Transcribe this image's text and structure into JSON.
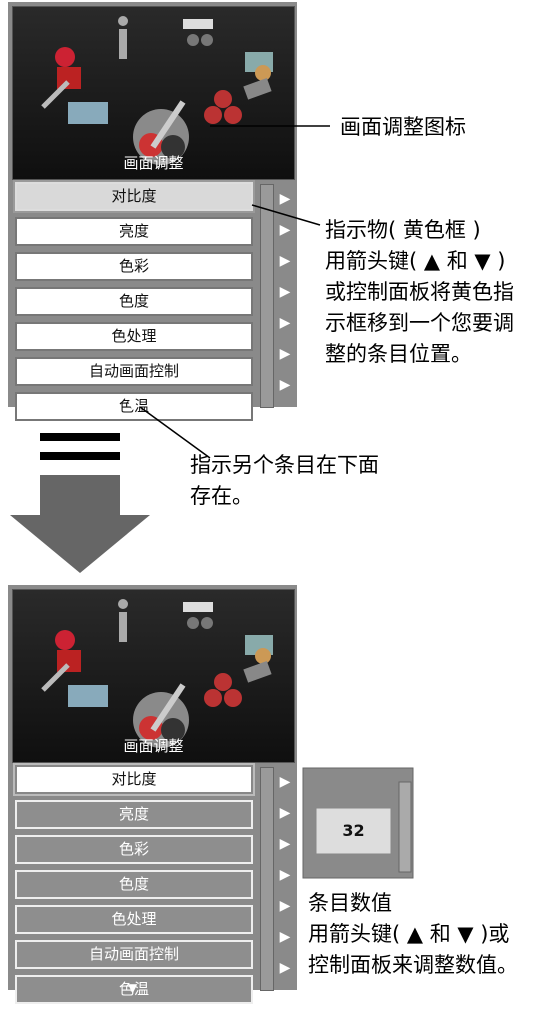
{
  "panel_top": {
    "icon_label": "画面调整",
    "items": [
      "对比度",
      "亮度",
      "色彩",
      "色度",
      "色处理",
      "自动画面控制",
      "色温"
    ]
  },
  "panel_bottom": {
    "icon_label": "画面调整",
    "items": [
      "对比度",
      "亮度",
      "色彩",
      "色度",
      "色处理",
      "自动画面控制",
      "色温"
    ],
    "value": "32"
  },
  "callouts": {
    "icon": "画面调整图标",
    "indicator_1": "指示物( 黄色框 )",
    "indicator_2": "用箭头键( ▲ 和 ▼ )",
    "indicator_3": "或控制面板将黄色指",
    "indicator_4": "示框移到一个您要调",
    "indicator_5": "整的条目位置。",
    "more_1": "指示另个条目在下面",
    "more_2": "存在。",
    "value_1": "条目数值",
    "value_2": "用箭头键( ▲ 和 ▼ )或",
    "value_3": "控制面板来调整数值。"
  }
}
